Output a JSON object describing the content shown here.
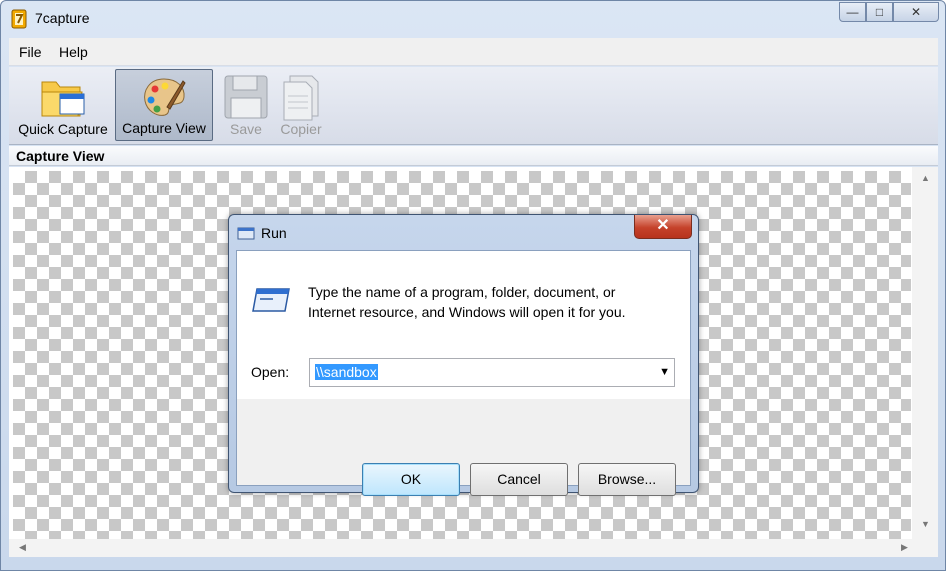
{
  "window": {
    "title": "7capture",
    "icon": "app-logo-icon",
    "controls": {
      "minimize": "—",
      "maximize": "□",
      "close": "✕"
    }
  },
  "menu": {
    "items": [
      "File",
      "Help"
    ]
  },
  "toolbar": {
    "items": [
      {
        "label": "Quick Capture",
        "icon": "folder-window-icon",
        "state": "normal"
      },
      {
        "label": "Capture View",
        "icon": "palette-icon",
        "state": "active"
      },
      {
        "label": "Save",
        "icon": "floppy-disk-icon",
        "state": "disabled"
      },
      {
        "label": "Copier",
        "icon": "copy-pages-icon",
        "state": "disabled"
      }
    ]
  },
  "section": {
    "title": "Capture View"
  },
  "dialog": {
    "title": "Run",
    "close": "✕",
    "description_line1": "Type the name of a program, folder, document, or",
    "description_line2": "Internet resource, and Windows will open it for you.",
    "open_label": "Open:",
    "open_value": "\\\\sandbox",
    "buttons": {
      "ok": "OK",
      "cancel": "Cancel",
      "browse": "Browse..."
    }
  },
  "colors": {
    "accent": "#3399ff",
    "close_red": "#c5422b",
    "checker": "#c8c8c8"
  }
}
